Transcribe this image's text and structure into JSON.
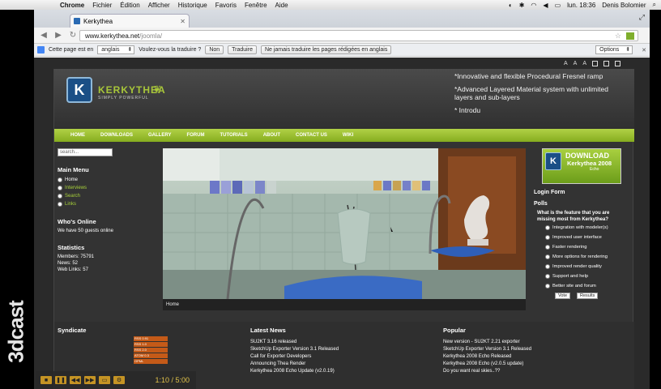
{
  "menubar": {
    "items": [
      "Chrome",
      "Fichier",
      "Édition",
      "Afficher",
      "Historique",
      "Favoris",
      "Fenêtre",
      "Aide"
    ],
    "clock": "lun. 18:36",
    "user": "Denis Bolomier"
  },
  "browser": {
    "tab_title": "Kerkythea",
    "url_host": "www.kerkythea.net",
    "url_path": "/joomla/"
  },
  "translate": {
    "prefix": "Cette page est en",
    "language": "anglais",
    "question": "Voulez-vous la traduire ?",
    "no": "Non",
    "translate": "Traduire",
    "never": "Ne jamais traduire les pages rédigées en anglais",
    "options": "Options"
  },
  "site": {
    "font_controls": [
      "A",
      "A",
      "A"
    ],
    "logo_name": "KERKYTHEA",
    "logo_tagline": "SIMPLY POWERFUL",
    "ticker": [
      "*Innovative  and flexible Procedural Fresnel ramp",
      "*Advanced Layered Material system with unlimited layers and sub-layers",
      "* Introdu"
    ],
    "nav": [
      "HOME",
      "DOWNLOADS",
      "GALLERY",
      "FORUM",
      "TUTORIALS",
      "ABOUT",
      "CONTACT US",
      "WIKI"
    ]
  },
  "left": {
    "search_placeholder": "search...",
    "main_menu_title": "Main Menu",
    "main_menu": [
      "Home",
      "Interviews",
      "Search",
      "Links"
    ],
    "whos_online_title": "Who's Online",
    "whos_online_text": "We have 50 guests online",
    "stats_title": "Statistics",
    "stats": [
      "Members: 75791",
      "News: 52",
      "Web Links: 57"
    ]
  },
  "banner": {
    "caption": "Home"
  },
  "right": {
    "download_line1": "DOWNLOAD",
    "download_line2": "Kerkythea 2008",
    "download_line3": "Echo",
    "login_title": "Login Form",
    "polls_title": "Polls",
    "poll_question": "What is the feature that you are missing most from Kerkythea?",
    "poll_options": [
      "Integration with modeler(s)",
      "Improved user interface",
      "Faster rendering",
      "More options for rendering",
      "Improved render quality",
      "Support and help",
      "Better site and forum"
    ],
    "vote": "Vote",
    "results": "Results"
  },
  "footer": {
    "syndicate_title": "Syndicate",
    "feeds": [
      "RSS 0.91",
      "RSS 1.0",
      "RSS 2.0",
      "ATOM 0.3",
      "OPML"
    ],
    "latest_title": "Latest News",
    "latest": [
      "SU2KT 3.16 released",
      "SketchUp Exporter Version 3.1 Released",
      "Call for Exporter Developers",
      "Announcing Thea Render",
      "Kerkythea 2008 Echo Update (v2.0.19)"
    ],
    "popular_title": "Popular",
    "popular": [
      "New version - SU2KT 2.21 exporter",
      "SketchUp Exporter Version 3.1 Released",
      "Kerkythea 2008 Echo Released",
      "Kerkythea 2008 Echo (v2.0.5 update)",
      "Do you want real skies..??"
    ]
  },
  "player": {
    "time": "1:10 / 5:00"
  },
  "watermark": "3dcast"
}
